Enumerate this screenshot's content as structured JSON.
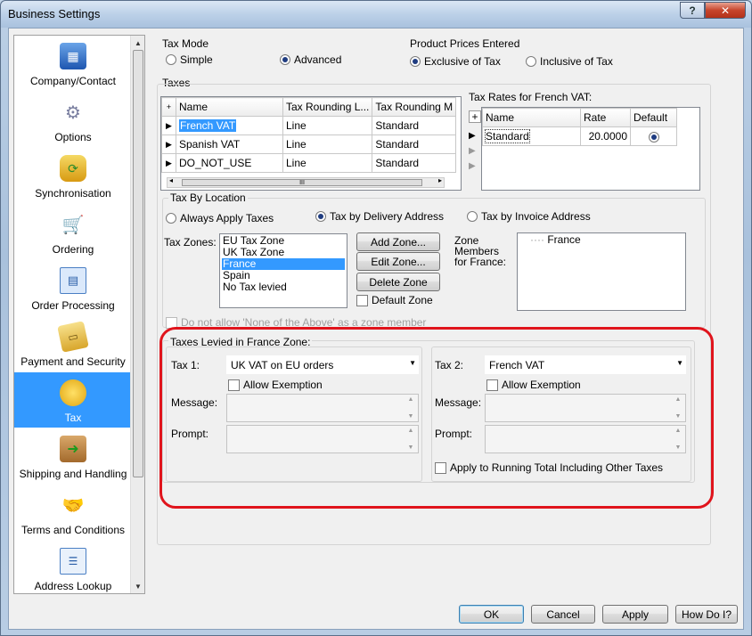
{
  "window": {
    "title": "Business Settings",
    "help_label": "?",
    "close_label": "✕"
  },
  "sidebar": {
    "items": [
      {
        "label": "Company/Contact",
        "icon": "building-icon"
      },
      {
        "label": "Options",
        "icon": "gears-icon"
      },
      {
        "label": "Synchronisation",
        "icon": "database-sync-icon"
      },
      {
        "label": "Ordering",
        "icon": "shopping-cart-icon"
      },
      {
        "label": "Order Processing",
        "icon": "spreadsheet-icon"
      },
      {
        "label": "Payment and Security",
        "icon": "credit-card-icon"
      },
      {
        "label": "Tax",
        "icon": "coins-icon"
      },
      {
        "label": "Shipping and Handling",
        "icon": "box-arrow-icon"
      },
      {
        "label": "Terms and Conditions",
        "icon": "handshake-icon"
      },
      {
        "label": "Address Lookup",
        "icon": "address-card-icon"
      }
    ],
    "selected": "Tax"
  },
  "tax_mode": {
    "label": "Tax Mode",
    "simple": "Simple",
    "advanced": "Advanced",
    "selected": "Advanced"
  },
  "product_prices": {
    "label": "Product Prices Entered",
    "exclusive": "Exclusive of Tax",
    "inclusive": "Inclusive of Tax",
    "selected": "Exclusive of Tax"
  },
  "taxes": {
    "label": "Taxes",
    "add": "+",
    "columns": [
      "Name",
      "Tax Rounding L...",
      "Tax Rounding M"
    ],
    "rows": [
      [
        "French VAT",
        "Line",
        "Standard"
      ],
      [
        "Spanish VAT",
        "Line",
        "Standard"
      ],
      [
        "DO_NOT_USE",
        "Line",
        "Standard"
      ]
    ],
    "hscroll_grip": "III"
  },
  "tax_rates": {
    "label": "Tax Rates for French VAT:",
    "add": "+",
    "columns": [
      "Name",
      "Rate",
      "Default"
    ],
    "rows": [
      [
        "Standard",
        "20.0000",
        ""
      ]
    ]
  },
  "tax_by_location": {
    "label": "Tax By Location",
    "always": "Always Apply Taxes",
    "delivery": "Tax by Delivery Address",
    "invoice": "Tax by Invoice Address",
    "selected": "Tax by Delivery Address",
    "zones_label": "Tax Zones:",
    "zones": [
      "EU Tax Zone",
      "UK Tax Zone",
      "France",
      "Spain",
      "No Tax levied"
    ],
    "selected_zone": "France",
    "add_zone": "Add Zone...",
    "edit_zone": "Edit Zone...",
    "delete_zone": "Delete Zone",
    "default_zone": "Default Zone",
    "members_label": "Zone Members for France:",
    "members": [
      "France"
    ],
    "none_above": "Do not allow 'None of the Above' as a zone member"
  },
  "levied": {
    "label": "Taxes Levied in France Zone:",
    "tax1_label": "Tax 1:",
    "tax1_value": "UK VAT on EU orders",
    "tax2_label": "Tax 2:",
    "tax2_value": "French VAT",
    "allow_exemption": "Allow Exemption",
    "message_label": "Message:",
    "prompt_label": "Prompt:",
    "running_total": "Apply to Running Total Including Other Taxes"
  },
  "footer": {
    "ok": "OK",
    "cancel": "Cancel",
    "apply": "Apply",
    "how_do_i": "How Do I?"
  },
  "colors": {
    "selection": "#3399ff",
    "highlight_ring": "#e0141c"
  }
}
